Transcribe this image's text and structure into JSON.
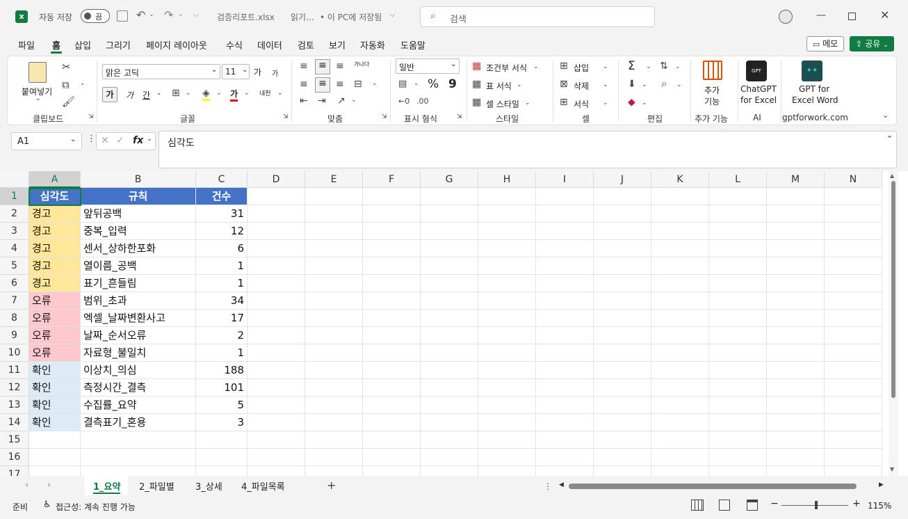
{
  "titlebar": {
    "autosave_label": "자동 저장",
    "autosave_state": "끔",
    "filename": "검증리포트.xlsx",
    "status": "읽기...",
    "save_location": "• 이 PC에 저장됨",
    "search_placeholder": "검색"
  },
  "tabs": [
    "파일",
    "홈",
    "삽입",
    "그리기",
    "페이지 레이아웃",
    "수식",
    "데이터",
    "검토",
    "보기",
    "자동화",
    "도움말"
  ],
  "active_tab": "홈",
  "memo_label": "메모",
  "share_label": "공유",
  "ribbon": {
    "clipboard": {
      "paste": "붙여넣기",
      "label": "클립보드"
    },
    "font": {
      "name": "맑은 고딕",
      "size": "11",
      "bold": "가",
      "italic": "가",
      "underline": "간",
      "strike": "가",
      "grow": "가",
      "shrink": "가",
      "phonetic": "내천",
      "label": "글꼴"
    },
    "align": {
      "wrap": "가나다",
      "label": "맞춤"
    },
    "number": {
      "format": "일반",
      "percent": "%",
      "comma": "9",
      "label": "표시 형식"
    },
    "styles": {
      "conditional": "조건부 서식",
      "table": "표 서식",
      "cell": "셀 스타일",
      "label": "스타일"
    },
    "cells": {
      "insert": "삽입",
      "delete": "삭제",
      "format": "서식",
      "label": "셀"
    },
    "editing": {
      "sum": "Σ",
      "label": "편집"
    },
    "addins": {
      "btn1": "추가",
      "btn2": "기능",
      "label": "추가 기능"
    },
    "ai": {
      "chatgpt1": "ChatGPT",
      "chatgpt2": "for Excel",
      "logo_text": "GPT",
      "label": "AI"
    },
    "gptword": {
      "l1": "GPT for",
      "l2": "Excel Word",
      "label": "gptforwork.com"
    }
  },
  "formula_bar": {
    "name_box": "A1",
    "fx": "fx",
    "value": "심각도"
  },
  "columns": [
    "A",
    "B",
    "C",
    "D",
    "E",
    "F",
    "G",
    "H",
    "I",
    "J",
    "K",
    "L",
    "M",
    "N"
  ],
  "rows": [
    "1",
    "2",
    "3",
    "4",
    "5",
    "6",
    "7",
    "8",
    "9",
    "10",
    "11",
    "12",
    "13",
    "14",
    "15",
    "16",
    "17"
  ],
  "table": {
    "headers": [
      "심각도",
      "규칙",
      "건수"
    ],
    "rows": [
      {
        "sev": "경고",
        "rule": "앞뒤공백",
        "count": "31",
        "color": "#ffe699"
      },
      {
        "sev": "경고",
        "rule": "중복_입력",
        "count": "12",
        "color": "#ffe699"
      },
      {
        "sev": "경고",
        "rule": "센서_상하한포화",
        "count": "6",
        "color": "#ffe699"
      },
      {
        "sev": "경고",
        "rule": "열이름_공백",
        "count": "1",
        "color": "#ffe699"
      },
      {
        "sev": "경고",
        "rule": "표기_흔들림",
        "count": "1",
        "color": "#ffe699"
      },
      {
        "sev": "오류",
        "rule": "범위_초과",
        "count": "34",
        "color": "#ffc7ce"
      },
      {
        "sev": "오류",
        "rule": "엑셀_날짜변환사고",
        "count": "17",
        "color": "#ffc7ce"
      },
      {
        "sev": "오류",
        "rule": "날짜_순서오류",
        "count": "2",
        "color": "#ffc7ce"
      },
      {
        "sev": "오류",
        "rule": "자료형_불일치",
        "count": "1",
        "color": "#ffc7ce"
      },
      {
        "sev": "확인",
        "rule": "이상치_의심",
        "count": "188",
        "color": "#ddebf7"
      },
      {
        "sev": "확인",
        "rule": "측정시간_결측",
        "count": "101",
        "color": "#ddebf7"
      },
      {
        "sev": "확인",
        "rule": "수집률_요약",
        "count": "5",
        "color": "#ddebf7"
      },
      {
        "sev": "확인",
        "rule": "결측표기_혼용",
        "count": "3",
        "color": "#ddebf7"
      }
    ]
  },
  "sheets": [
    "1_요약",
    "2_파일별",
    "3_상세",
    "4_파일목록"
  ],
  "active_sheet": "1_요약",
  "status": {
    "ready": "준비",
    "accessibility": "접근성: 계속 진행 가능",
    "zoom": "115%"
  }
}
